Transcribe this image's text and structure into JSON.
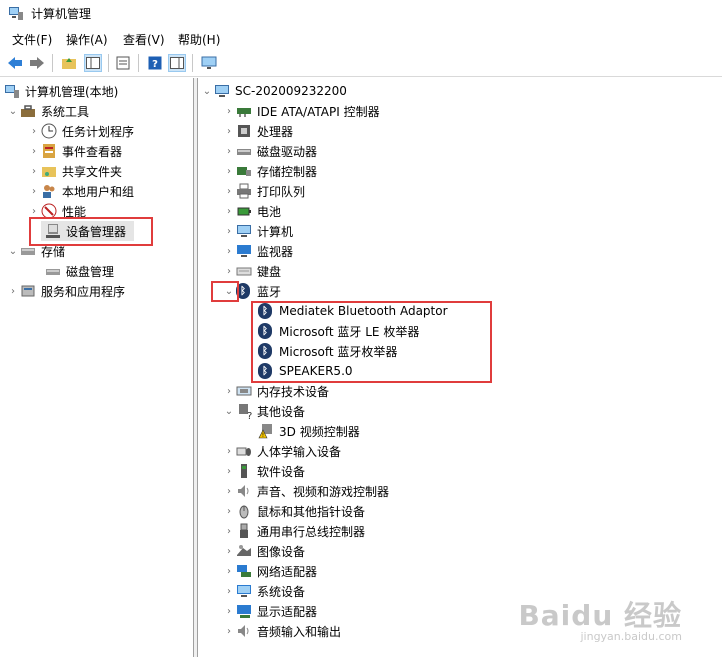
{
  "window": {
    "title": "计算机管理"
  },
  "menu": [
    "文件(F)",
    "操作(A)",
    "查看(V)",
    "帮助(H)"
  ],
  "left_tree": {
    "root": "计算机管理(本地)",
    "system_tools": "系统工具",
    "task_scheduler": "任务计划程序",
    "event_viewer": "事件查看器",
    "shared_folders": "共享文件夹",
    "local_users": "本地用户和组",
    "performance": "性能",
    "device_manager": "设备管理器",
    "storage": "存储",
    "disk_management": "磁盘管理",
    "services": "服务和应用程序"
  },
  "device_tree": {
    "computer": "SC-202009232200",
    "categories": [
      "IDE ATA/ATAPI 控制器",
      "处理器",
      "磁盘驱动器",
      "存储控制器",
      "打印队列",
      "电池",
      "计算机",
      "监视器",
      "键盘",
      "蓝牙"
    ],
    "bluetooth_devices": [
      "Mediatek Bluetooth Adaptor",
      "Microsoft 蓝牙 LE 枚举器",
      "Microsoft 蓝牙枚举器",
      "SPEAKER5.0"
    ],
    "memory_tech": "内存技术设备",
    "other_devices": "其他设备",
    "video_controller": "3D 视频控制器",
    "rest": [
      "人体学输入设备",
      "软件设备",
      "声音、视频和游戏控制器",
      "鼠标和其他指针设备",
      "通用串行总线控制器",
      "图像设备",
      "网络适配器",
      "系统设备",
      "显示适配器",
      "音频输入和输出"
    ]
  },
  "watermark": {
    "brand": "Baidu 经验",
    "url": "jingyan.baidu.com"
  },
  "colors": {
    "highlight_box": "#e03c3c",
    "bluetooth_icon": "#1f3a66",
    "selection": "#e5e5e5"
  }
}
